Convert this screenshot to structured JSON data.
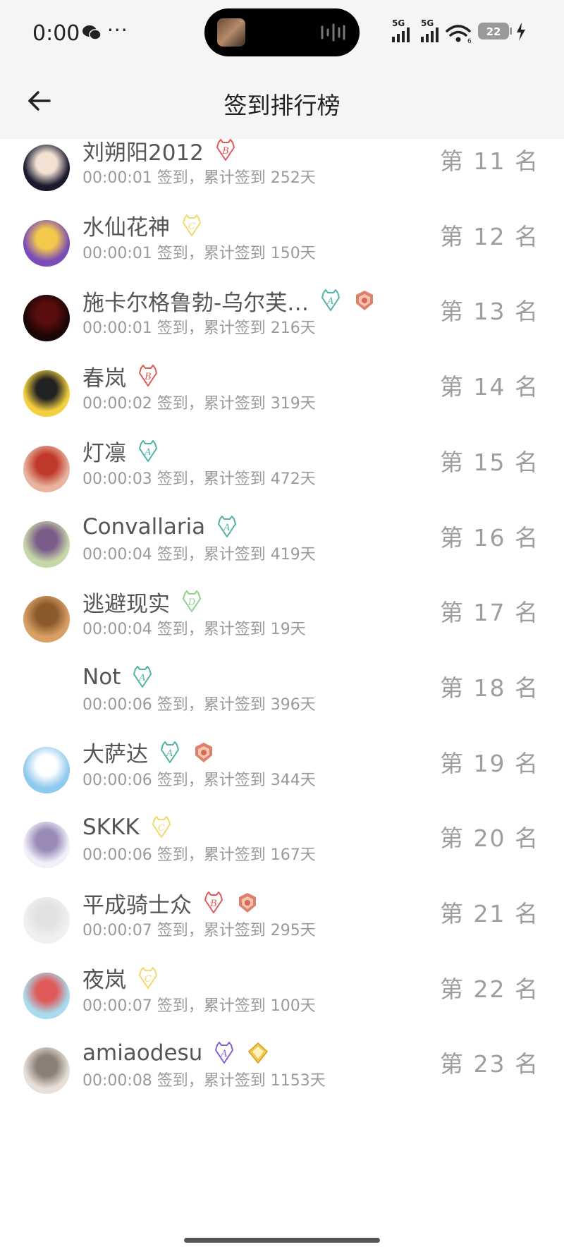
{
  "status_bar": {
    "time": "0:00",
    "dots": "···",
    "network_1": "5G",
    "network_2": "5G",
    "battery": "22"
  },
  "header": {
    "title": "签到排行榜"
  },
  "rows": [
    {
      "name": "刘朔阳2012",
      "detail": "00:00:01 签到，累计签到 252天",
      "rank": "第 11 名",
      "avatar": [
        "#1a1a2e",
        "#f3e2d4"
      ],
      "badges": [
        {
          "type": "b",
          "letter": "B",
          "color": "#e05a5a"
        }
      ]
    },
    {
      "name": "水仙花神",
      "detail": "00:00:01 签到，累计签到 150天",
      "rank": "第 12 名",
      "avatar": [
        "#7b4bb7",
        "#f2c94c"
      ],
      "badges": [
        {
          "type": "c",
          "letter": "C",
          "color": "#f2d96b"
        }
      ]
    },
    {
      "name": "施卡尔格鲁勃-乌尔芙…",
      "detail": "00:00:01 签到，累计签到 216天",
      "rank": "第 13 名",
      "avatar": [
        "#1b0606",
        "#5a0d0d"
      ],
      "badges": [
        {
          "type": "a",
          "letter": "A",
          "color": "#4fb3a5"
        },
        {
          "type": "crest",
          "color": "#d86a50"
        }
      ]
    },
    {
      "name": "春岚",
      "detail": "00:00:02 签到，累计签到 319天",
      "rank": "第 14 名",
      "avatar": [
        "#f4d03f",
        "#222222"
      ],
      "badges": [
        {
          "type": "b",
          "letter": "B",
          "color": "#e05a5a"
        }
      ]
    },
    {
      "name": "灯凛",
      "detail": "00:00:03 签到，累计签到 472天",
      "rank": "第 15 名",
      "avatar": [
        "#e8b4a0",
        "#c0392b"
      ],
      "badges": [
        {
          "type": "a",
          "letter": "A",
          "color": "#4fb3a5"
        }
      ]
    },
    {
      "name": "Convallaria",
      "detail": "00:00:04 签到，累计签到 419天",
      "rank": "第 16 名",
      "avatar": [
        "#c7d8a8",
        "#7a5c8a"
      ],
      "badges": [
        {
          "type": "a",
          "letter": "A",
          "color": "#4fb3a5"
        }
      ]
    },
    {
      "name": "逃避现实",
      "detail": "00:00:04 签到，累计签到 19天",
      "rank": "第 17 名",
      "avatar": [
        "#d9a066",
        "#8a5a2b"
      ],
      "badges": [
        {
          "type": "d",
          "letter": "D",
          "color": "#8fd18f"
        }
      ]
    },
    {
      "name": "Not",
      "detail": "00:00:06 签到，累计签到 396天",
      "rank": "第 18 名",
      "avatar": [
        "#ffffff",
        "#ffffff"
      ],
      "badges": [
        {
          "type": "a",
          "letter": "A",
          "color": "#4fb3a5"
        }
      ]
    },
    {
      "name": "大萨达",
      "detail": "00:00:06 签到，累计签到 344天",
      "rank": "第 19 名",
      "avatar": [
        "#8ec9ee",
        "#ffffff"
      ],
      "badges": [
        {
          "type": "a",
          "letter": "A",
          "color": "#4fb3a5"
        },
        {
          "type": "crest",
          "color": "#d86a50"
        }
      ]
    },
    {
      "name": "SKKK",
      "detail": "00:00:06 签到，累计签到 167天",
      "rank": "第 20 名",
      "avatar": [
        "#f0f0f8",
        "#9a8ab8"
      ],
      "badges": [
        {
          "type": "c",
          "letter": "C",
          "color": "#f2d96b"
        }
      ]
    },
    {
      "name": "平成骑士众",
      "detail": "00:00:07 签到，累计签到 295天",
      "rank": "第 21 名",
      "avatar": [
        "#f0f0f0",
        "#e2e2e2"
      ],
      "badges": [
        {
          "type": "b",
          "letter": "B",
          "color": "#e05a5a"
        },
        {
          "type": "crest",
          "color": "#d86a50"
        }
      ]
    },
    {
      "name": "夜岚",
      "detail": "00:00:07 签到，累计签到 100天",
      "rank": "第 22 名",
      "avatar": [
        "#a7dcef",
        "#e05a5a"
      ],
      "badges": [
        {
          "type": "c",
          "letter": "C",
          "color": "#f2d96b"
        }
      ]
    },
    {
      "name": "amiaodesu",
      "detail": "00:00:08 签到，累计签到 1153天",
      "rank": "第 23 名",
      "avatar": [
        "#e8e0d8",
        "#8a8077"
      ],
      "badges": [
        {
          "type": "a",
          "letter": "A",
          "color": "#8a5fd6"
        },
        {
          "type": "gem",
          "color": "#f2c94c"
        }
      ]
    }
  ]
}
